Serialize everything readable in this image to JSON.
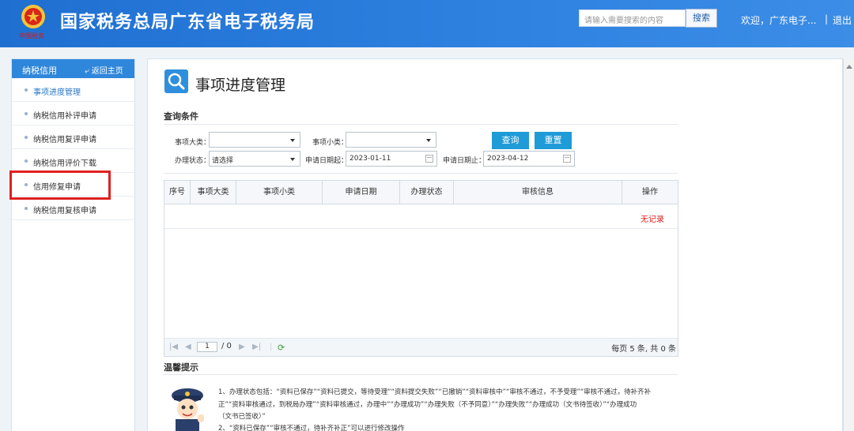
{
  "header": {
    "emblem_caption": "中国税务",
    "site_title": "国家税务总局广东省电子税务局",
    "search_placeholder": "请输入需要搜索的内容",
    "search_button": "搜索",
    "welcome": "欢迎，广东电子...",
    "divider": "|",
    "logout": "退出"
  },
  "sidebar": {
    "title": "纳税信用",
    "back_home": "返回主页",
    "items": [
      {
        "label": "事项进度管理"
      },
      {
        "label": "纳税信用补评申请"
      },
      {
        "label": "纳税信用复评申请"
      },
      {
        "label": "纳税信用评价下载"
      },
      {
        "label": "信用修复申请"
      },
      {
        "label": "纳税信用复核申请"
      }
    ]
  },
  "main": {
    "page_title": "事项进度管理",
    "query_section": "查询条件",
    "filters": {
      "major_label": "事项大类：",
      "minor_label": "事项小类：",
      "status_label": "办理状态：",
      "status_value": "请选择",
      "start_label": "申请日期起：",
      "start_value": "2023-01-11",
      "end_label": "申请日期止：",
      "end_value": "2023-04-12",
      "query_button": "查询",
      "reset_button": "重置"
    },
    "table": {
      "columns": [
        "序号",
        "事项大类",
        "事项小类",
        "申请日期",
        "办理状态",
        "审核信息",
        "操作"
      ],
      "no_records": "无记录"
    },
    "pager": {
      "page_value": "1",
      "total_pages": "/ 0",
      "info": "每页 5 条, 共 0 条"
    },
    "tips": {
      "title": "温馨提示",
      "line1": "1、办理状态包括：“资料已保存”“资料已提交，等待受理”“资料提交失败”“已撤销”“资料审核中”“审核不通过，不予受理”“审核不通过，待补齐补",
      "line2": "正”“资料审核通过，到税局办理”“资料审核通过，办理中”“办理成功”“办理失败（不予同意）”“办理失败”“办理成功（文书待签收）”“办理成功",
      "line3": "（文书已签收）”",
      "line4": "2、“资料已保存”“审核不通过，待补齐补正”可以进行修改操作"
    }
  },
  "colors": {
    "header_blue": "#2f82e0",
    "accent_button": "#1f9bd8",
    "highlight_red": "#e02020"
  }
}
